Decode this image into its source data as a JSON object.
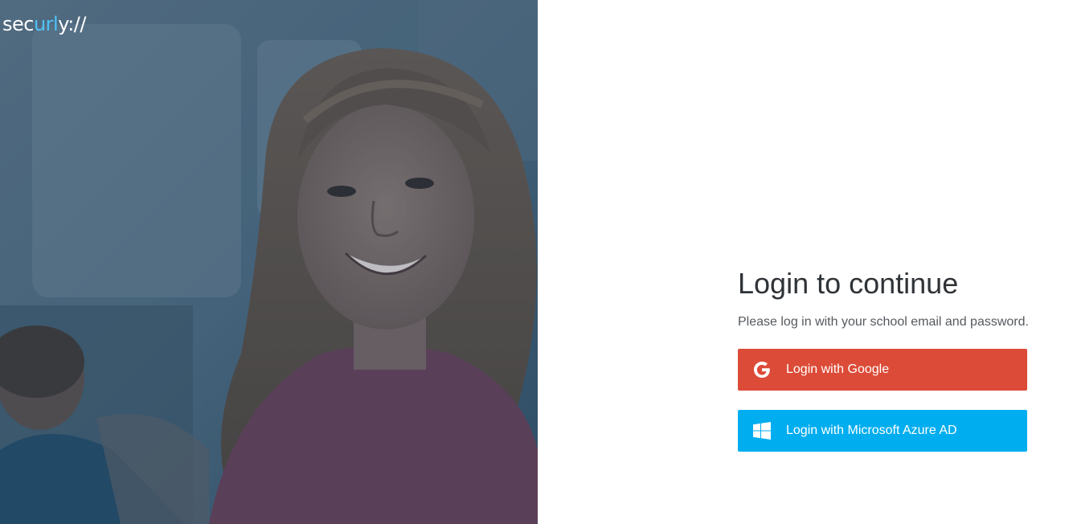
{
  "brand": {
    "logo_prefix": "sec",
    "logo_accent": "url",
    "logo_suffix": "y",
    "logo_slashes": "://",
    "accent_color": "#4fc3f7"
  },
  "login": {
    "title": "Login to continue",
    "subtitle": "Please log in with your school email and password.",
    "buttons": [
      {
        "label": "Login with Google",
        "icon": "google-g-icon",
        "color": "#dc4b37"
      },
      {
        "label": "Login with Microsoft Azure AD",
        "icon": "windows-icon",
        "color": "#00adef"
      }
    ]
  }
}
